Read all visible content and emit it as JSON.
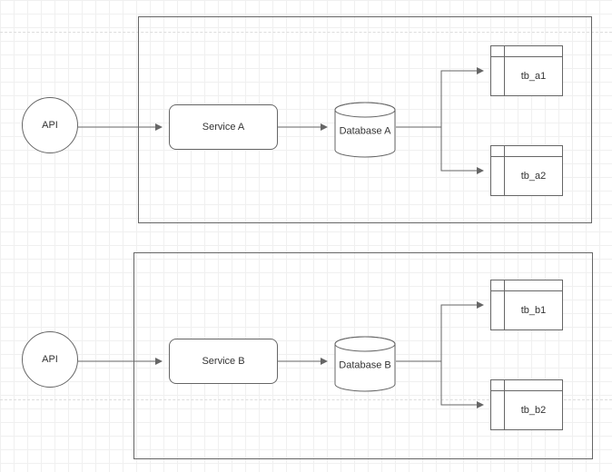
{
  "top": {
    "api_label": "API",
    "service_label": "Service A",
    "database_label": "Database A",
    "table1_label": "tb_a1",
    "table2_label": "tb_a2"
  },
  "bottom": {
    "api_label": "API",
    "service_label": "Service B",
    "database_label": "Database B",
    "table1_label": "tb_b1",
    "table2_label": "tb_b2"
  }
}
